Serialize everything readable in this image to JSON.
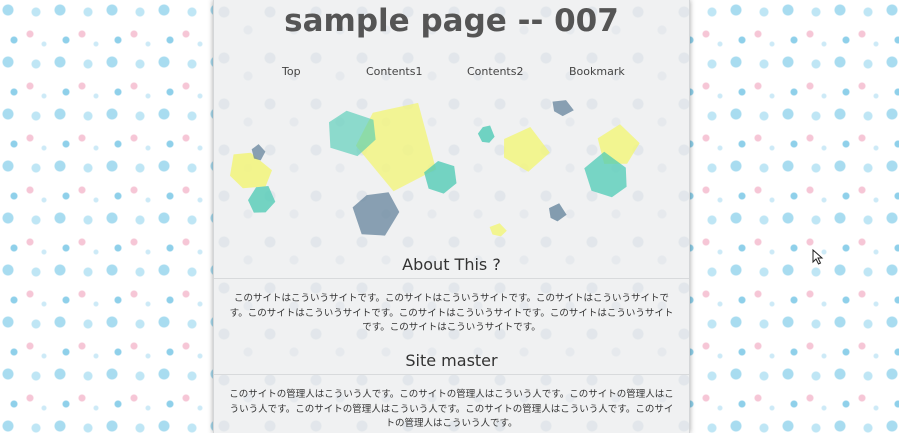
{
  "header": {
    "title": "sample page -- 007"
  },
  "nav": {
    "items": [
      {
        "label": "Top"
      },
      {
        "label": "Contents1"
      },
      {
        "label": "Contents2"
      },
      {
        "label": "Bookmark"
      }
    ]
  },
  "sections": [
    {
      "heading": "About This ?",
      "body": "このサイトはこういうサイトです。このサイトはこういうサイトです。このサイトはこういうサイトです。このサイトはこういうサイトです。このサイトはこういうサイトです。このサイトはこういうサイトです。このサイトはこういうサイトです。"
    },
    {
      "heading": "Site master",
      "body": "このサイトの管理人はこういう人です。このサイトの管理人はこういう人です。このサイトの管理人はこういう人です。このサイトの管理人はこういう人です。このサイトの管理人はこういう人です。このサイトの管理人はこういう人です。"
    }
  ],
  "colors": {
    "background": "#ffffff",
    "page": "#f0f1f2",
    "title_text": "#555555",
    "body_text": "#333333",
    "shape_yellow": "#f2f57a",
    "shape_teal": "#4fcbb5",
    "shape_slate": "#5f7f98",
    "pattern_blue": "#a8dcf0",
    "pattern_pink": "#f6c6d6"
  },
  "icons": {
    "cursor": "mouse-pointer-icon"
  }
}
